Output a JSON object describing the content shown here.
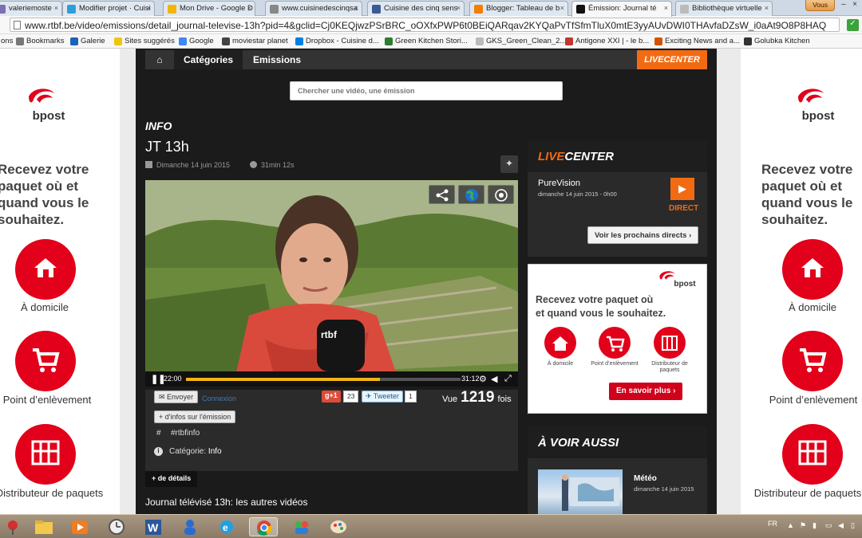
{
  "browser": {
    "tabs": [
      {
        "label": "valeriemoste",
        "color": "#7d6fb0"
      },
      {
        "label": "Modifier projet · Cuisi",
        "color": "#2d9fd8"
      },
      {
        "label": "Mon Drive - Google D",
        "color": "#f4b400"
      },
      {
        "label": "www.cuisinedescinqsa",
        "color": "#888888"
      },
      {
        "label": "Cuisine des cinq sens",
        "color": "#3b5998"
      },
      {
        "label": "Blogger: Tableau de b",
        "color": "#f57d00"
      },
      {
        "label": "Émission: Journal té",
        "color": "#111111"
      },
      {
        "label": "Bibliothèque virtuelle",
        "color": "#bbbbbb"
      }
    ],
    "user_button": "Vous",
    "url": "www.rtbf.be/video/emissions/detail_journal-televise-13h?pid=4&gclid=Cj0KEQjwzPSrBRC_oOXfxPWP6t0BEiQARqav2KYQaPvTfSfmTluX0mtE3yyAUvDWI0THAvfaDZsW_i0aAt9O8P8HAQ",
    "bookmarks": [
      {
        "label": "ons",
        "color": "#999999"
      },
      {
        "label": "Bookmarks",
        "color": "#777777"
      },
      {
        "label": "Galerie",
        "color": "#1c62b9"
      },
      {
        "label": "Sites suggérés",
        "color": "#f1c40f"
      },
      {
        "label": "Google",
        "color": "#4285f4"
      },
      {
        "label": "moviestar planet",
        "color": "#444444"
      },
      {
        "label": "Dropbox - Cuisine d...",
        "color": "#007ee5"
      },
      {
        "label": "Green Kitchen Stori...",
        "color": "#2e7d32"
      },
      {
        "label": "GKS_Green_Clean_2...",
        "color": "#bbbbbb"
      },
      {
        "label": "Antigone XXI | - le b...",
        "color": "#c0392b"
      },
      {
        "label": "Exciting News and a...",
        "color": "#d35400"
      },
      {
        "label": "Golubka Kitchen",
        "color": "#333333"
      }
    ]
  },
  "ad": {
    "brand": "bpost",
    "slogan_lines": [
      "Recevez votre",
      "paquet où et",
      "quand vous le",
      "souhaitez."
    ],
    "services": [
      "À domicile",
      "Point d’enlèvement",
      "Distributeur de paquets"
    ]
  },
  "site": {
    "nav": {
      "home": "⌂",
      "categories": "Catégories",
      "emissions": "Emissions",
      "livecenter": "LIVECENTER"
    },
    "search_placeholder": "Chercher une vidéo, une émission",
    "section": "INFO",
    "title": "JT 13h",
    "date": "Dimanche 14 juin 2015",
    "duration": "31min 12s",
    "player": {
      "current": "22:00",
      "total": "31:12",
      "progress": 0.705
    },
    "share": {
      "send": "Envoyer",
      "login": "Connexion",
      "gplus": "g+1",
      "gplus_count": "23",
      "tweet": "Tweeter",
      "tweet_count": "1"
    },
    "views": {
      "label": "Vue",
      "count": "1219",
      "suffix": "fois"
    },
    "more_info": "+ d'infos sur l'émission",
    "hashtag_icon": "#",
    "hashtag": "#rtbfinfo",
    "info_icon": "i",
    "category_label": "Catégorie:",
    "category_value": "Info",
    "details_button": "+ de détails",
    "others": "Journal télévisé 13h: les autres vidéos",
    "live": {
      "title_live": "LIVE",
      "title_center": "CENTER",
      "channel": "PureVision",
      "date": "dimanche 14 juin 2015 - 0h00",
      "direct": "DIRECT",
      "next": "Voir les prochains directs"
    },
    "side_ad": {
      "brand": "bpost",
      "lines": [
        "Recevez votre paquet où",
        "et quand vous le souhaitez."
      ],
      "services": [
        "À domicile",
        "Point d’enlèvement",
        "Distributeur de paquets"
      ],
      "cta": "En savoir plus"
    },
    "voir": {
      "title": "À VOIR AUSSI",
      "item": "Météo",
      "date": "dimanche 14 juin 2015"
    }
  },
  "taskbar": {
    "lang": "FR"
  },
  "colors": {
    "rtbf_orange": "#f26b13",
    "bpost_red": "#e2001a",
    "site_dark": "#1b1b1b"
  }
}
